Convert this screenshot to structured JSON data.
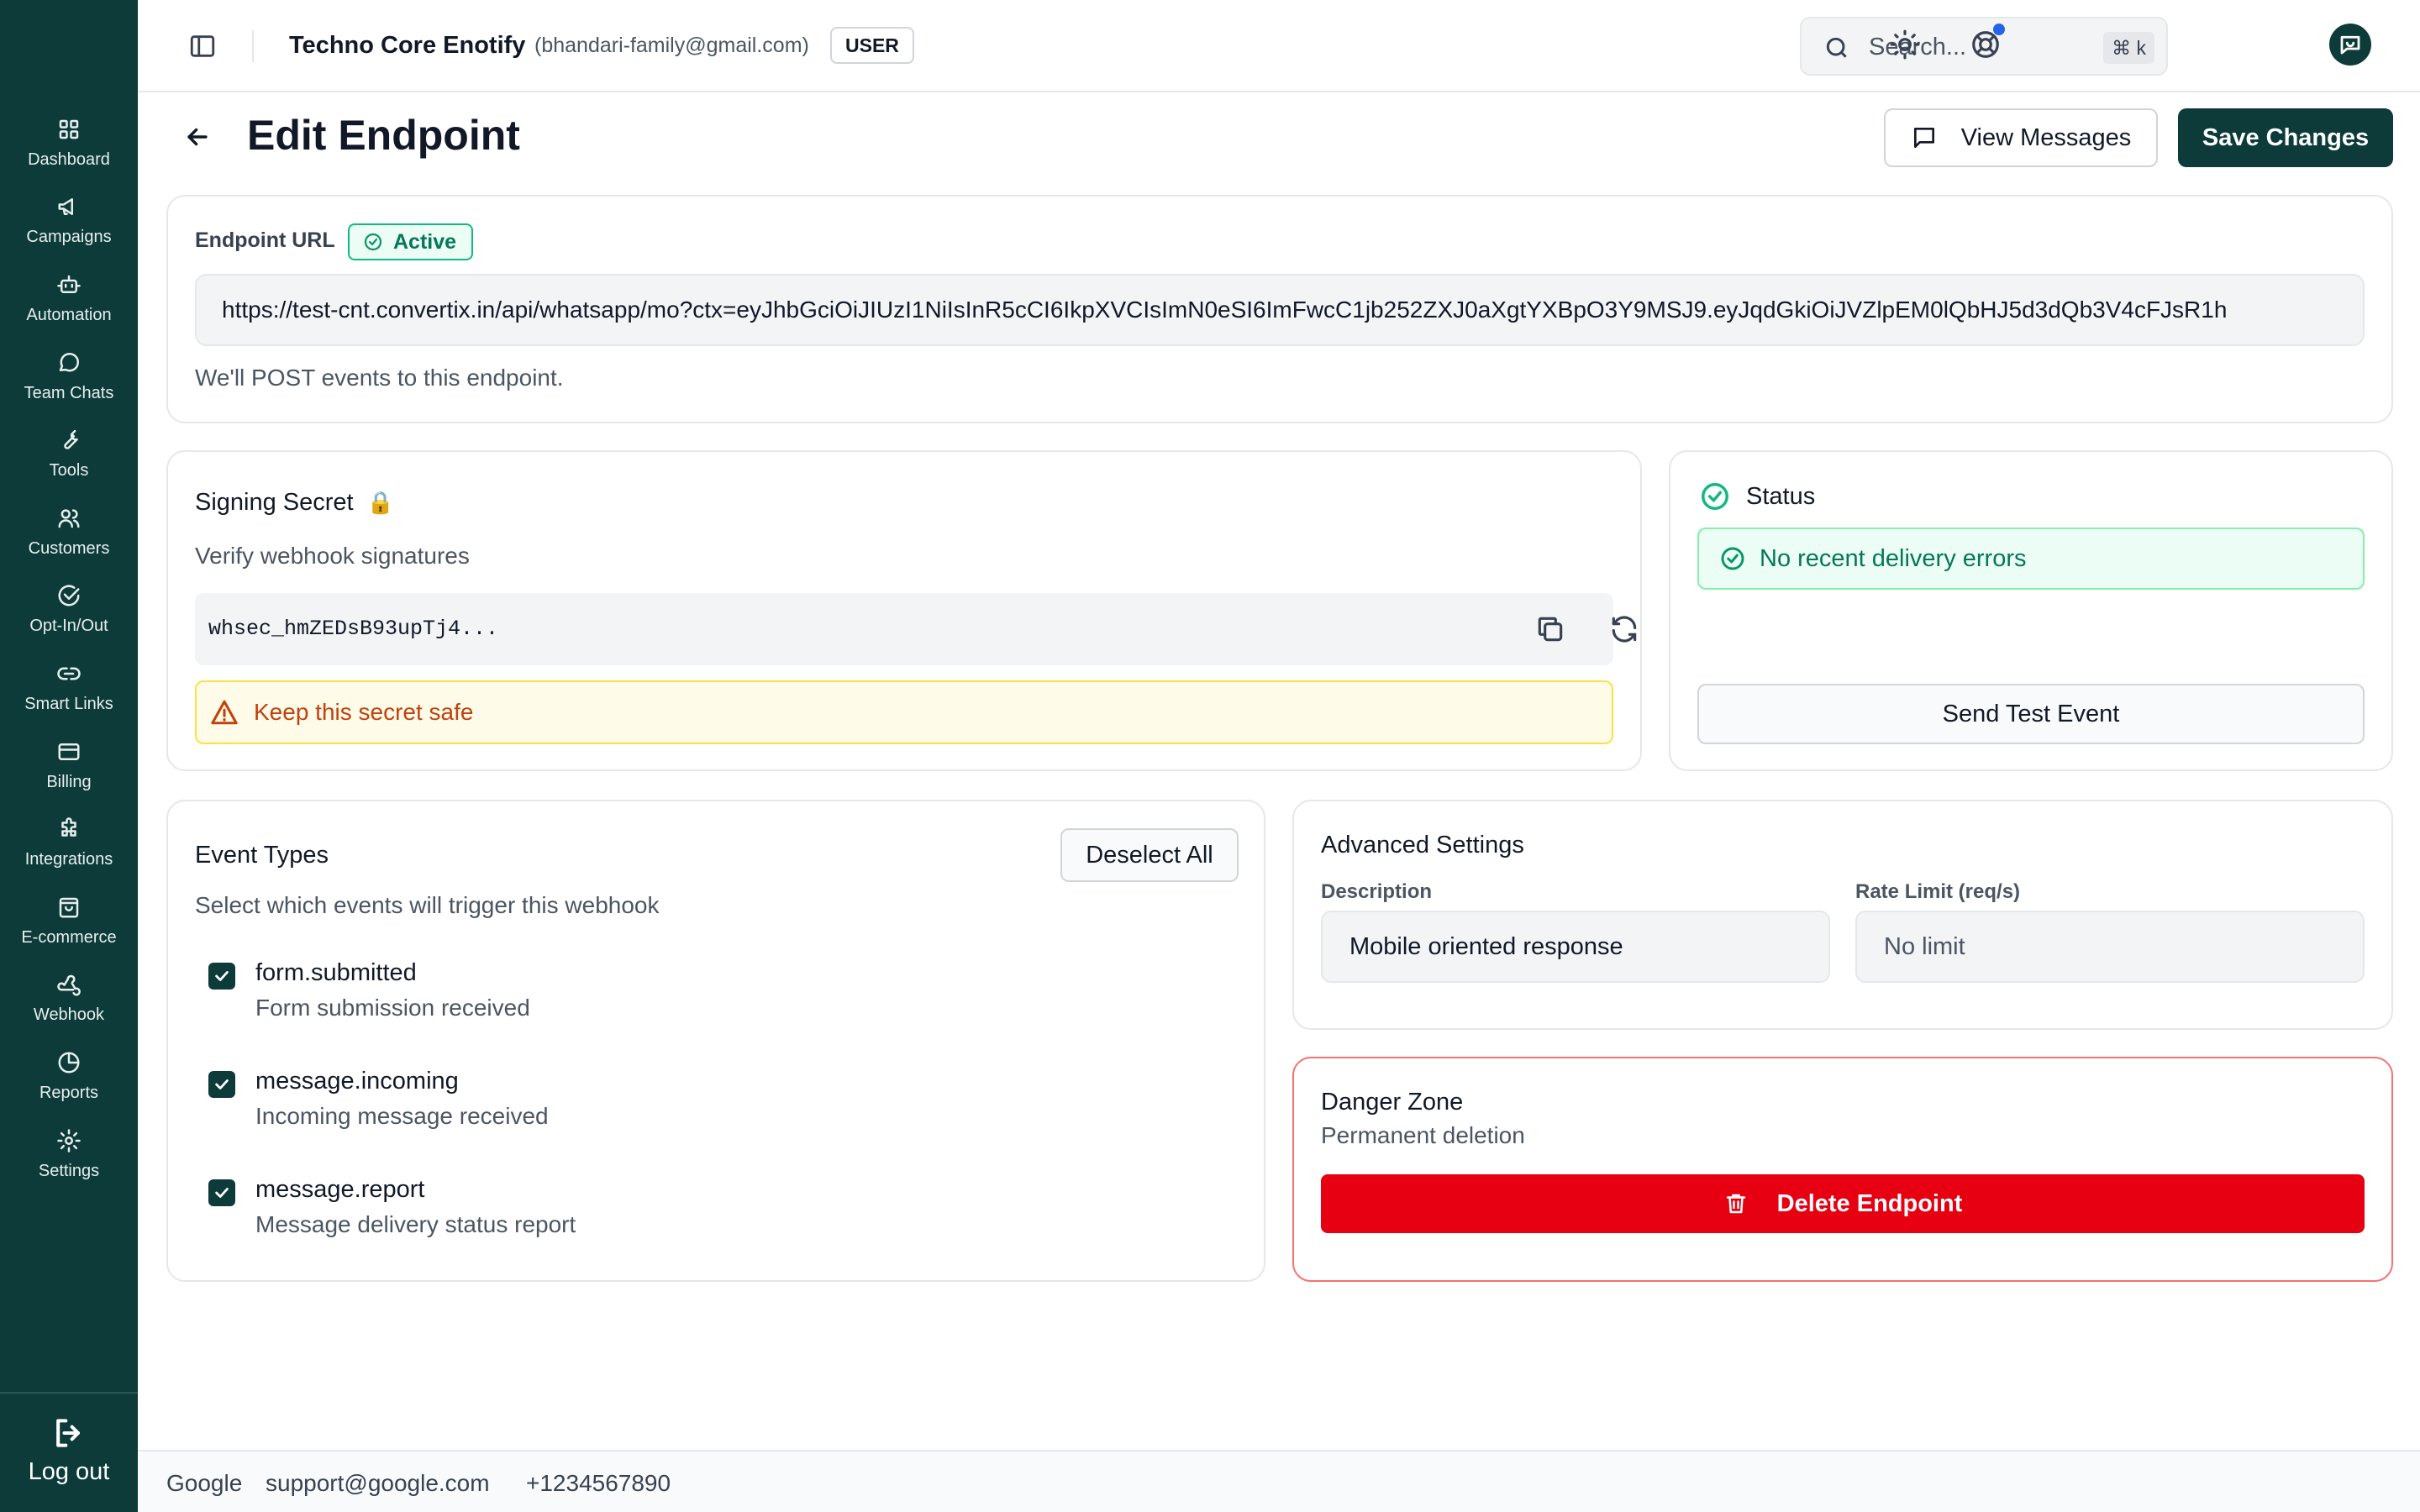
{
  "sidebar": {
    "items": [
      {
        "label": "Dashboard",
        "icon": "grid-icon"
      },
      {
        "label": "Campaigns",
        "icon": "megaphone-icon"
      },
      {
        "label": "Automation",
        "icon": "bot-icon"
      },
      {
        "label": "Team Chats",
        "icon": "chat-bubble-icon"
      },
      {
        "label": "Tools",
        "icon": "wrench-icon"
      },
      {
        "label": "Customers",
        "icon": "users-icon"
      },
      {
        "label": "Opt-In/Out",
        "icon": "check-circle-icon"
      },
      {
        "label": "Smart Links",
        "icon": "link-icon"
      },
      {
        "label": "Billing",
        "icon": "credit-card-icon"
      },
      {
        "label": "Integrations",
        "icon": "puzzle-icon"
      },
      {
        "label": "E-commerce",
        "icon": "shopping-bag-icon"
      },
      {
        "label": "Webhook",
        "icon": "webhook-icon"
      },
      {
        "label": "Reports",
        "icon": "pie-chart-icon"
      },
      {
        "label": "Settings",
        "icon": "gear-icon"
      }
    ],
    "logout_label": "Log out"
  },
  "header": {
    "org_name": "Techno Core Enotify",
    "org_email": "(bhandari-family@gmail.com)",
    "role": "USER",
    "search_placeholder": "Search...",
    "search_shortcut": "⌘ k"
  },
  "page": {
    "title": "Edit Endpoint",
    "view_messages_label": "View Messages",
    "save_label": "Save Changes"
  },
  "endpoint": {
    "label": "Endpoint URL",
    "status_badge": "Active",
    "url": "https://test-cnt.convertix.in/api/whatsapp/mo?ctx=eyJhbGciOiJIUzI1NiIsInR5cCI6IkpXVCIsImN0eSI6ImFwcC1jb252ZXJ0aXgtYXBpO3Y9MSJ9.eyJqdGkiOiJVZlpEM0lQbHJ5d3dQb3V4cFJsR1h",
    "help": "We'll POST events to this endpoint."
  },
  "signing": {
    "title": "Signing Secret",
    "lock_emoji": "🔒",
    "subtitle": "Verify webhook signatures",
    "secret": "whsec_hmZEDsB93upTj4...",
    "warning": "Keep this secret safe"
  },
  "status": {
    "title": "Status",
    "message": "No recent delivery errors",
    "test_button": "Send Test Event"
  },
  "events": {
    "title": "Event Types",
    "subtitle": "Select which events will trigger this webhook",
    "deselect_label": "Deselect All",
    "items": [
      {
        "name": "form.submitted",
        "description": "Form submission received",
        "checked": true
      },
      {
        "name": "message.incoming",
        "description": "Incoming message received",
        "checked": true
      },
      {
        "name": "message.report",
        "description": "Message delivery status report",
        "checked": true
      }
    ]
  },
  "advanced": {
    "title": "Advanced Settings",
    "description_label": "Description",
    "description_value": "Mobile oriented response",
    "rate_label": "Rate Limit (req/s)",
    "rate_placeholder": "No limit"
  },
  "danger": {
    "title": "Danger Zone",
    "subtitle": "Permanent deletion",
    "delete_label": "Delete Endpoint"
  },
  "footer": {
    "company": "Google",
    "email": "support@google.com",
    "phone": "+1234567890"
  },
  "colors": {
    "brand": "#0d3b3a",
    "success": "#10b981",
    "danger": "#e60012",
    "warning": "#c2410c",
    "notification_dot": "#2563eb"
  }
}
